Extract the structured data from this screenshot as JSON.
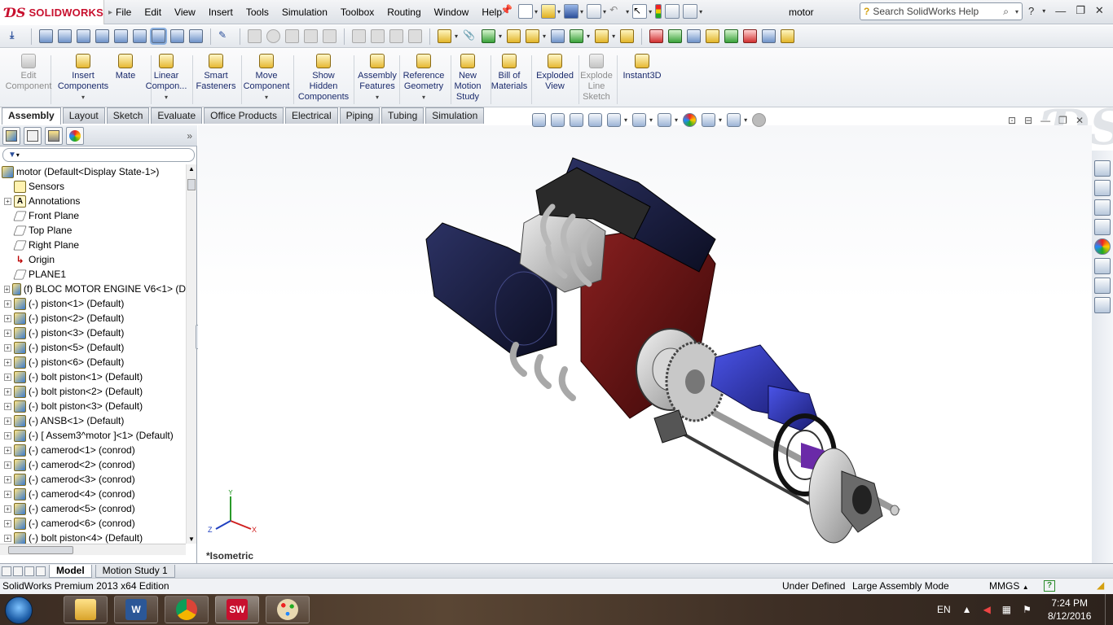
{
  "app": {
    "brand": "SOLIDWORKS",
    "doc_title": "motor",
    "help_placeholder": "Search SolidWorks Help"
  },
  "menu": [
    "File",
    "Edit",
    "View",
    "Insert",
    "Tools",
    "Simulation",
    "Toolbox",
    "Routing",
    "Window",
    "Help"
  ],
  "command_manager": [
    {
      "label": "Edit\nComponent",
      "enabled": false
    },
    {
      "label": "Insert\nComponents",
      "enabled": true,
      "dropdown": true
    },
    {
      "label": "Mate",
      "enabled": true
    },
    {
      "label": "Linear\nCompon...",
      "enabled": true,
      "dropdown": true
    },
    {
      "label": "Smart\nFasteners",
      "enabled": true
    },
    {
      "label": "Move\nComponent",
      "enabled": true,
      "dropdown": true
    },
    {
      "label": "Show\nHidden\nComponents",
      "enabled": true
    },
    {
      "label": "Assembly\nFeatures",
      "enabled": true,
      "dropdown": true
    },
    {
      "label": "Reference\nGeometry",
      "enabled": true,
      "dropdown": true
    },
    {
      "label": "New\nMotion\nStudy",
      "enabled": true
    },
    {
      "label": "Bill of\nMaterials",
      "enabled": true
    },
    {
      "label": "Exploded\nView",
      "enabled": true
    },
    {
      "label": "Explode\nLine\nSketch",
      "enabled": false
    },
    {
      "label": "Instant3D",
      "enabled": true
    }
  ],
  "tabs": [
    {
      "label": "Assembly",
      "active": true
    },
    {
      "label": "Layout"
    },
    {
      "label": "Sketch"
    },
    {
      "label": "Evaluate"
    },
    {
      "label": "Office Products"
    },
    {
      "label": "Electrical"
    },
    {
      "label": "Piping"
    },
    {
      "label": "Tubing"
    },
    {
      "label": "Simulation"
    }
  ],
  "tree": [
    {
      "label": "motor  (Default<Display State-1>)",
      "type": "root"
    },
    {
      "label": "Sensors",
      "type": "sensor",
      "expander": false
    },
    {
      "label": "Annotations",
      "type": "ann",
      "expander": true
    },
    {
      "label": "Front Plane",
      "type": "plane"
    },
    {
      "label": "Top Plane",
      "type": "plane"
    },
    {
      "label": "Right Plane",
      "type": "plane"
    },
    {
      "label": "Origin",
      "type": "origin"
    },
    {
      "label": "PLANE1",
      "type": "plane"
    },
    {
      "label": "(f) BLOC MOTOR ENGINE V6<1> (D",
      "type": "part",
      "expander": true
    },
    {
      "label": "(-) piston<1> (Default)",
      "type": "part",
      "expander": true
    },
    {
      "label": "(-) piston<2> (Default)",
      "type": "part",
      "expander": true
    },
    {
      "label": "(-) piston<3> (Default)",
      "type": "part",
      "expander": true
    },
    {
      "label": "(-) piston<5> (Default)",
      "type": "part",
      "expander": true
    },
    {
      "label": "(-) piston<6> (Default)",
      "type": "part",
      "expander": true
    },
    {
      "label": "(-) bolt piston<1> (Default)",
      "type": "part",
      "expander": true
    },
    {
      "label": "(-) bolt piston<2> (Default)",
      "type": "part",
      "expander": true
    },
    {
      "label": "(-) bolt piston<3> (Default)",
      "type": "part",
      "expander": true
    },
    {
      "label": "(-) ANSB<1> (Default)",
      "type": "part",
      "expander": true
    },
    {
      "label": "(-) [ Assem3^motor ]<1> (Default)",
      "type": "part",
      "expander": true
    },
    {
      "label": "(-) camerod<1> (conrod)",
      "type": "part",
      "expander": true
    },
    {
      "label": "(-) camerod<2> (conrod)",
      "type": "part",
      "expander": true
    },
    {
      "label": "(-) camerod<3> (conrod)",
      "type": "part",
      "expander": true
    },
    {
      "label": "(-) camerod<4> (conrod)",
      "type": "part",
      "expander": true
    },
    {
      "label": "(-) camerod<5> (conrod)",
      "type": "part",
      "expander": true
    },
    {
      "label": "(-) camerod<6> (conrod)",
      "type": "part",
      "expander": true
    },
    {
      "label": "(-) bolt piston<4> (Default)",
      "type": "part",
      "expander": true
    }
  ],
  "viewport": {
    "view_label": "*Isometric",
    "axes": {
      "x": "X",
      "y": "Y",
      "z": "Z"
    }
  },
  "bottom_tabs": [
    {
      "label": "Model",
      "active": true
    },
    {
      "label": "Motion Study 1"
    }
  ],
  "status": {
    "edition": "SolidWorks Premium 2013 x64 Edition",
    "state": "Under Defined",
    "mode": "Large Assembly Mode",
    "units": "MMGS"
  },
  "taskbar": {
    "lang": "EN",
    "time": "7:24 PM",
    "date": "8/12/2016"
  },
  "colors": {
    "brand_red": "#c8102e",
    "engine_blue": "#1c2040",
    "engine_red": "#6a1414",
    "viewport_bg": "#ffffff"
  }
}
